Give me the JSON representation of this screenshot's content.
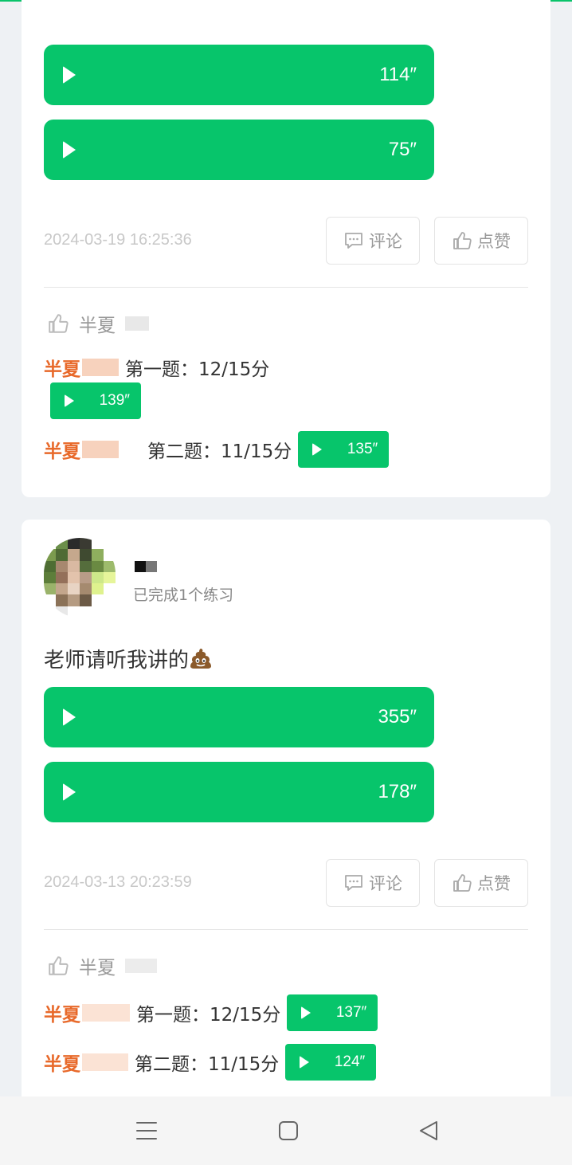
{
  "colors": {
    "accent": "#07c56b",
    "username": "#e8692a",
    "page_bg": "#eef1f4"
  },
  "posts": [
    {
      "voices": [
        "114″",
        "75″"
      ],
      "date": "2024-03-19 16:25:36",
      "comment_label": "评论",
      "like_label": "点赞",
      "liker": "半夏",
      "replies": [
        {
          "user": "半夏",
          "question": "第一题：12/15分",
          "voice": "139″"
        },
        {
          "user": "半夏",
          "question": "第二题：11/15分",
          "voice": "135″"
        }
      ]
    },
    {
      "author_sub": "已完成1个练习",
      "text": "老师请听我讲的",
      "emoji": "pile-of-poo-icon",
      "voices": [
        "355″",
        "178″"
      ],
      "date": "2024-03-13 20:23:59",
      "comment_label": "评论",
      "like_label": "点赞",
      "liker": "半夏",
      "replies": [
        {
          "user": "半夏",
          "question": "第一题：12/15分",
          "voice": "137″"
        },
        {
          "user": "半夏",
          "question": "第二题：11/15分",
          "voice": "124″"
        }
      ]
    }
  ],
  "navbar": {
    "icons": [
      "menu-icon",
      "home-square-icon",
      "back-triangle-icon"
    ]
  }
}
